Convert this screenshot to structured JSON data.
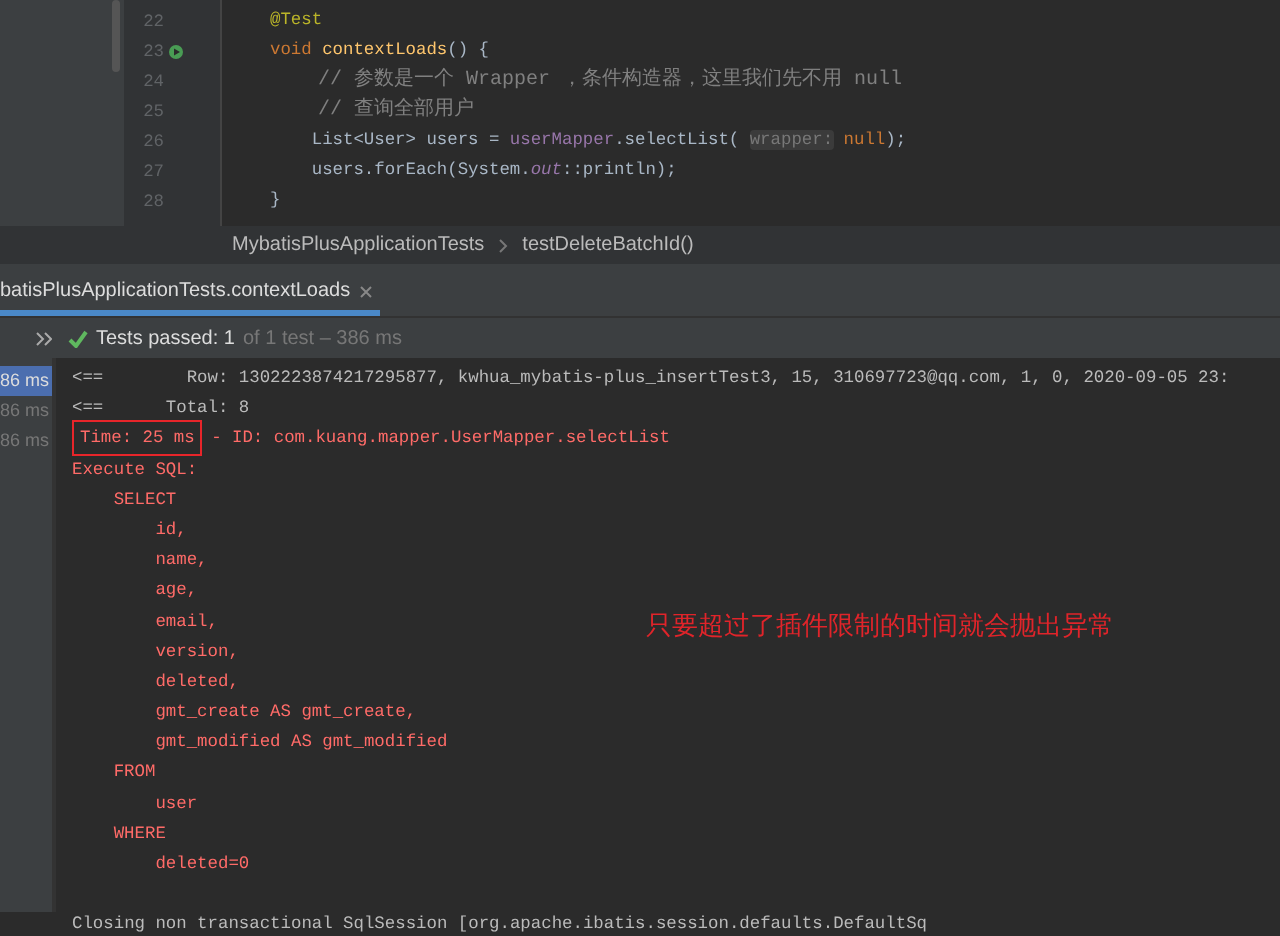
{
  "editor": {
    "lines": [
      {
        "number": "22",
        "tokens": [
          {
            "text": "@Test",
            "kind": "annotation"
          }
        ]
      },
      {
        "number": "23",
        "run_icon": true,
        "tokens": [
          {
            "text": "void ",
            "kind": "keyword"
          },
          {
            "text": "contextLoads",
            "kind": "method"
          },
          {
            "text": "() {",
            "kind": "plain"
          }
        ]
      },
      {
        "number": "24",
        "tokens": [
          {
            "text": "    // 参数是一个 Wrapper ，条件构造器，这里我们先不用 null",
            "kind": "comment"
          }
        ]
      },
      {
        "number": "25",
        "tokens": [
          {
            "text": "    // 查询全部用户",
            "kind": "comment"
          }
        ]
      },
      {
        "number": "26",
        "tokens": [
          {
            "text": "    List<User> users = ",
            "kind": "plain"
          },
          {
            "text": "userMapper",
            "kind": "field"
          },
          {
            "text": ".selectList( ",
            "kind": "plain"
          },
          {
            "text": "wrapper:",
            "kind": "hint"
          },
          {
            "text": " null",
            "kind": "keyword"
          },
          {
            "text": ");",
            "kind": "plain"
          }
        ]
      },
      {
        "number": "27",
        "tokens": [
          {
            "text": "    users.forEach(System.",
            "kind": "plain"
          },
          {
            "text": "out",
            "kind": "static"
          },
          {
            "text": "::println);",
            "kind": "plain"
          }
        ]
      },
      {
        "number": "28",
        "tokens": [
          {
            "text": "}",
            "kind": "plain"
          }
        ]
      }
    ]
  },
  "breadcrumb": [
    "MybatisPlusApplicationTests",
    "testDeleteBatchId()"
  ],
  "run_tab": {
    "label": "batisPlusApplicationTests.contextLoads",
    "selected": true
  },
  "test_status": {
    "passed": "Tests passed: 1",
    "detail": "of 1 test – 386 ms"
  },
  "test_times": [
    {
      "label": "86 ms",
      "selected": true
    },
    {
      "label": "86 ms",
      "selected": false
    },
    {
      "label": "86 ms",
      "selected": false
    }
  ],
  "console": [
    {
      "kind": "normal",
      "text": "<==        Row: 1302223874217295877, kwhua_mybatis-plus_insertTest3, 15, 310697723@qq.com, 1, 0, 2020-09-05 23:"
    },
    {
      "kind": "normal",
      "text": "<==      Total: 8"
    },
    {
      "kind": "sql",
      "boxed_text": "Time: 25 ms",
      "text": " - ID: com.kuang.mapper.UserMapper.selectList"
    },
    {
      "kind": "sql",
      "text": "Execute SQL:",
      "children": [
        {
          "kind": "sql",
          "text": "SELECT",
          "children": [
            {
              "kind": "sql",
              "text": "id,"
            },
            {
              "kind": "sql",
              "text": "name,"
            },
            {
              "kind": "sql",
              "text": "age,"
            },
            {
              "kind": "sql",
              "text": "email,"
            },
            {
              "kind": "sql",
              "text": "version,"
            },
            {
              "kind": "sql",
              "text": "deleted,"
            },
            {
              "kind": "sql",
              "text": "gmt_create AS gmt_create,"
            },
            {
              "kind": "sql",
              "text": "gmt_modified AS gmt_modified"
            }
          ]
        },
        {
          "kind": "sql",
          "text": "FROM",
          "children": [
            {
              "kind": "sql",
              "text": "user"
            }
          ]
        },
        {
          "kind": "sql",
          "text": "WHERE",
          "children": [
            {
              "kind": "sql",
              "text": "deleted=0"
            }
          ]
        }
      ]
    },
    {
      "kind": "blank"
    },
    {
      "kind": "normal",
      "text": "Closing non transactional SqlSession [org.apache.ibatis.session.defaults.DefaultSq"
    }
  ],
  "annotation": "只要超过了插件限制的时间就会抛出异常"
}
